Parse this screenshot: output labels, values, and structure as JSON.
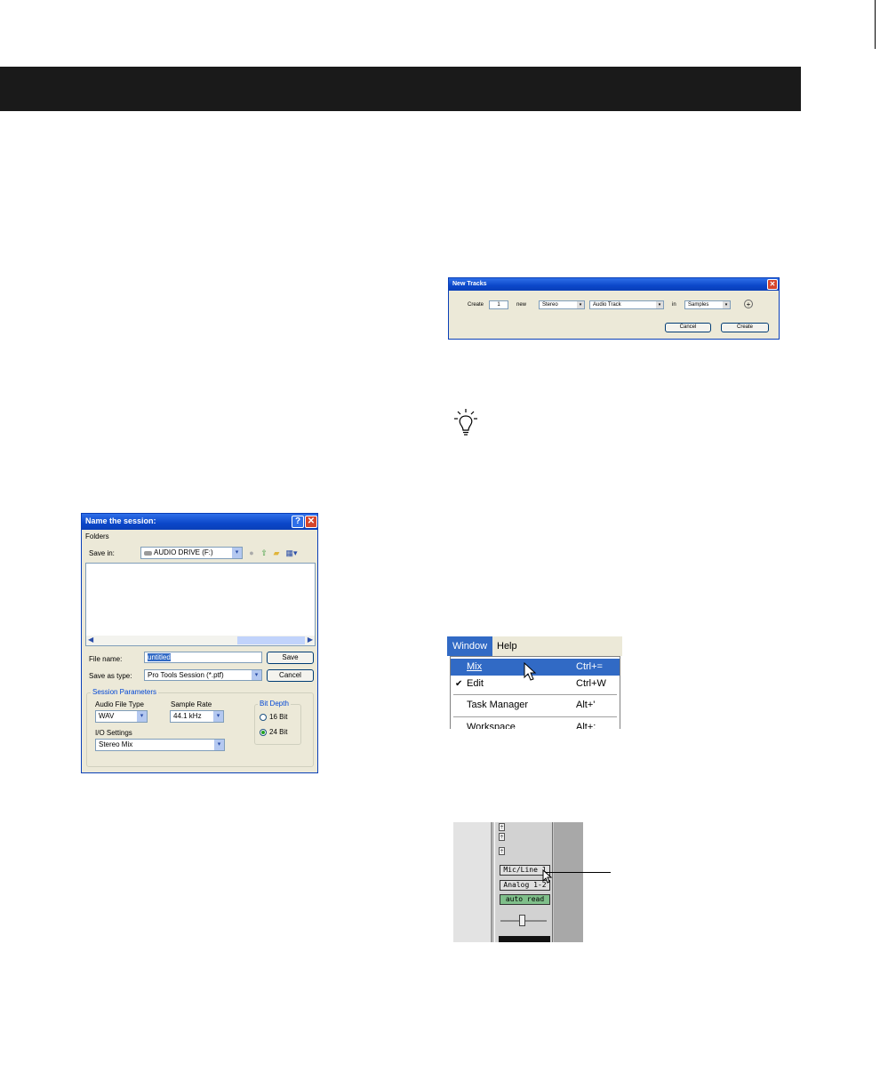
{
  "name_session_dialog": {
    "title": "Name the session:",
    "folders_label": "Folders",
    "save_in_label": "Save in:",
    "save_in_value": "AUDIO DRIVE (F:)",
    "file_name_label": "File name:",
    "file_name_value": "untitled",
    "save_as_type_label": "Save as type:",
    "save_as_type_value": "Pro Tools Session (*.ptf)",
    "save_button": "Save",
    "cancel_button": "Cancel",
    "session_parameters_label": "Session Parameters",
    "audio_file_type_label": "Audio File Type",
    "audio_file_type_value": "WAV",
    "sample_rate_label": "Sample Rate",
    "sample_rate_value": "44.1 kHz",
    "bit_depth_label": "Bit Depth",
    "bit_depth_options": [
      "16 Bit",
      "24 Bit"
    ],
    "bit_depth_selected": "24 Bit",
    "io_settings_label": "I/O Settings",
    "io_settings_value": "Stereo Mix",
    "help_glyph": "?",
    "close_glyph": "✕"
  },
  "new_tracks_dialog": {
    "title": "New Tracks",
    "create_label": "Create",
    "count_value": "1",
    "new_label": "new",
    "format_value": "Stereo",
    "track_type_value": "Audio Track",
    "in_label": "in",
    "timebase_value": "Samples",
    "add_glyph": "+",
    "cancel_button": "Cancel",
    "create_button": "Create",
    "close_glyph": "✕"
  },
  "window_menu": {
    "menubar": [
      "Window",
      "Help"
    ],
    "items": [
      {
        "label": "Mix",
        "shortcut": "Ctrl+=",
        "highlighted": true,
        "checked": false
      },
      {
        "label": "Edit",
        "shortcut": "Ctrl+W",
        "highlighted": false,
        "checked": true
      },
      {
        "label": "Task Manager",
        "shortcut": "Alt+'",
        "highlighted": false,
        "checked": false
      },
      {
        "label": "Workspace",
        "shortcut": "Alt+;",
        "highlighted": false,
        "checked": false
      }
    ],
    "check_glyph": "✔"
  },
  "mixer_strip": {
    "input_selector": "Mic/Line 1",
    "output_selector": "Analog 1-2",
    "automation_mode": "auto read",
    "fader_level": 0.5
  },
  "colors": {
    "xp_title_blue": "#0b47c9",
    "menu_highlight": "#316ac5",
    "header_bar": "#1a1a1a",
    "automation_green": "#7fbf8a"
  },
  "icons": [
    "help-icon",
    "close-icon",
    "drive-icon",
    "back-icon",
    "up-folder-icon",
    "new-folder-icon",
    "views-icon",
    "lightbulb-tip-icon",
    "mouse-pointer-icon",
    "add-icon"
  ]
}
